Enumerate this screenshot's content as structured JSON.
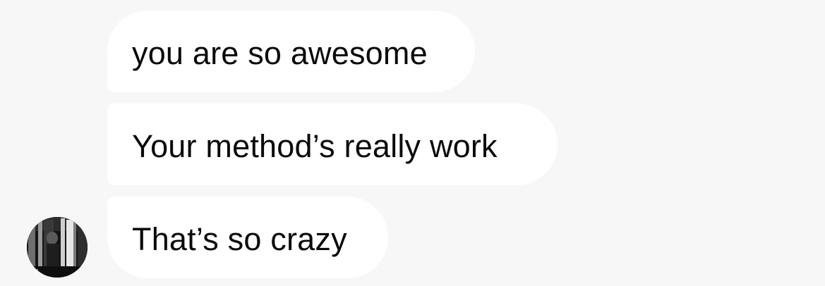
{
  "chat": {
    "messages": [
      {
        "text": "you are so awesome"
      },
      {
        "text": "Your method’s really work"
      },
      {
        "text": "That’s so crazy"
      }
    ]
  },
  "avatar": {
    "icon": "user-photo-avatar"
  },
  "colors": {
    "background": "#f7f7f7",
    "bubble": "#ffffff",
    "text": "#0a0a0a"
  }
}
